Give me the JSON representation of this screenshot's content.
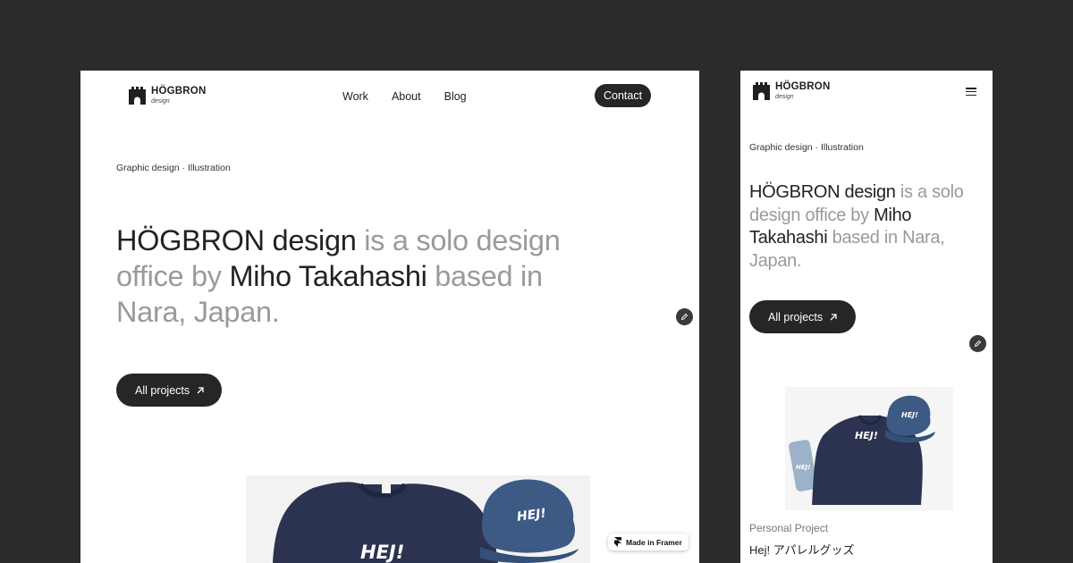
{
  "brand": {
    "name": "HÖGBRON",
    "sub": "design"
  },
  "desktop": {
    "nav": [
      "Work",
      "About",
      "Blog"
    ],
    "contact_label": "Contact",
    "tags": "Graphic design · Illustration",
    "headline": {
      "part1": "HÖGBRON design",
      "part2": " is a solo design office by ",
      "part3": "Miho Takahashi",
      "part4": " based in Nara, Japan."
    },
    "projects_label": "All projects",
    "framer_badge": "Made in Framer",
    "image_icon": "apparel-photo"
  },
  "mobile": {
    "tags": "Graphic design · Illustration",
    "headline": {
      "part1": "HÖGBRON design",
      "part2": " is a solo design office by ",
      "part3": "Miho Takahashi",
      "part4": " based in Nara, Japan."
    },
    "projects_label": "All projects",
    "project_category": "Personal Project",
    "project_title": "Hej! アパレルグッズ"
  },
  "apparel_text": "HEJ!",
  "colors": {
    "background": "#2b2b2b",
    "accent": "#262626",
    "muted_text": "#9a9a9a",
    "navy": "#2c3350",
    "denim": "#3d5a85"
  }
}
